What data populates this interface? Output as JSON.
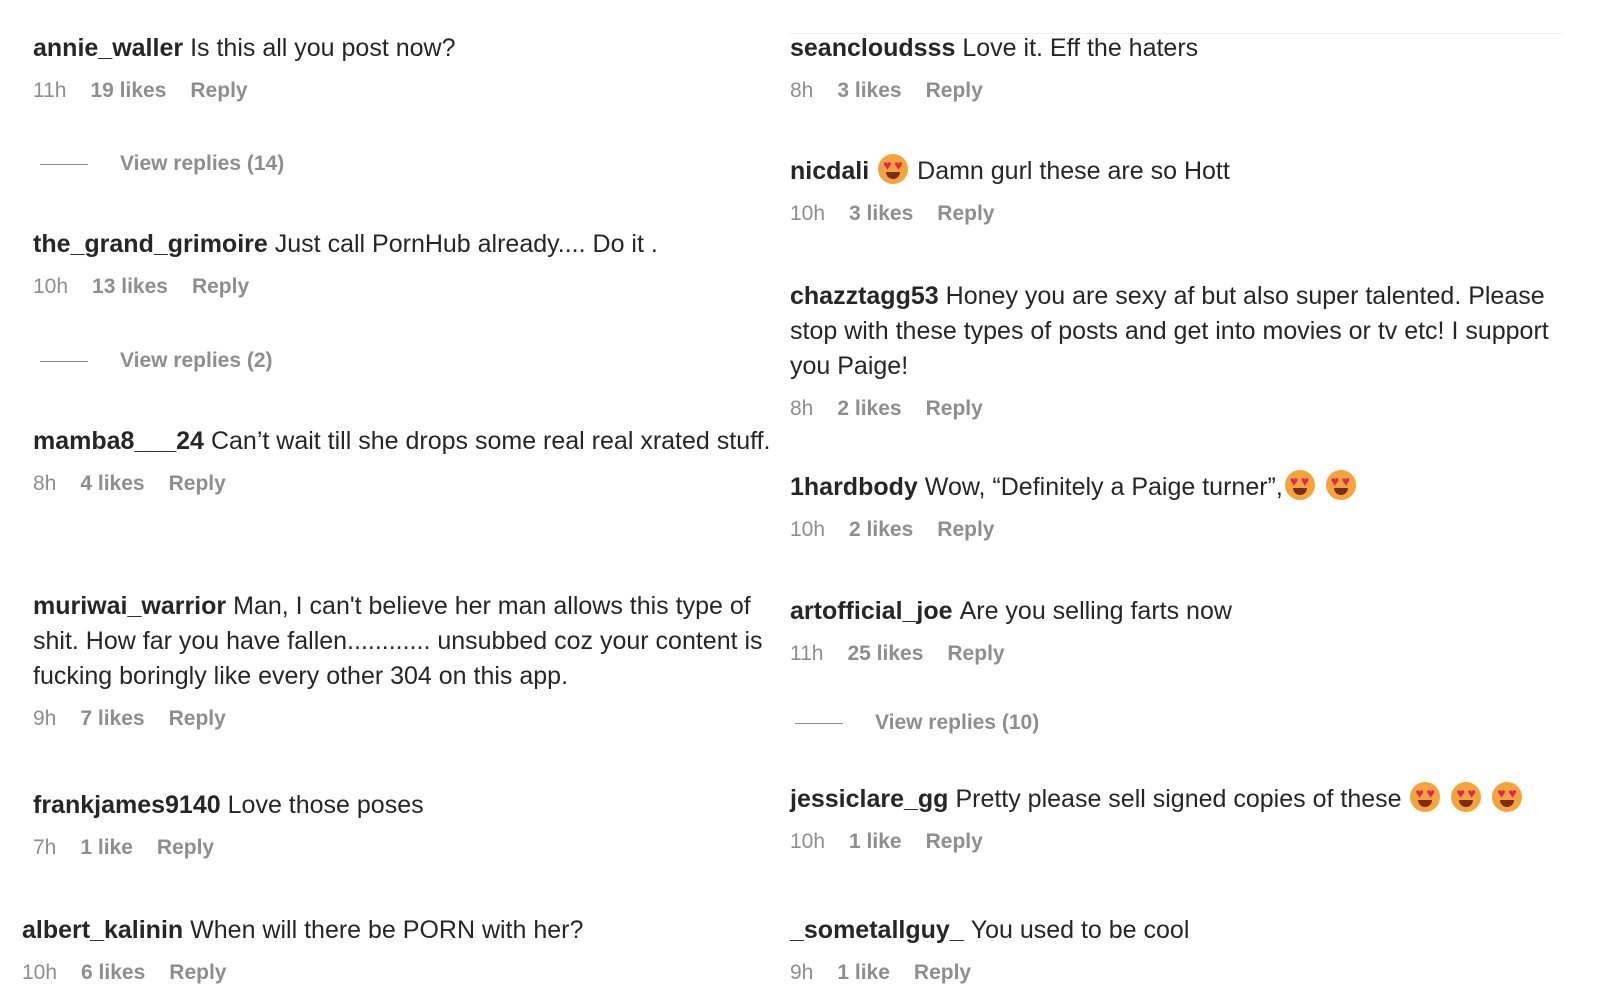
{
  "left_column": {
    "comments": [
      {
        "user": "annie_waller",
        "text": "Is this all you post now?",
        "time": "11h",
        "likes": "19 likes",
        "reply": "Reply"
      },
      {
        "user": "the_grand_grimoire",
        "text": "Just call PornHub already.... Do it .",
        "time": "10h",
        "likes": "13 likes",
        "reply": "Reply"
      },
      {
        "user": "mamba8___24",
        "text": "Can’t wait till she drops some real real xrated stuff.",
        "time": "8h",
        "likes": "4 likes",
        "reply": "Reply"
      },
      {
        "user": "muriwai_warrior",
        "text": "Man, I can't believe her man allows this type of shit. How far you have fallen............ unsubbed coz your content is fucking boringly like every other 304 on this app.",
        "time": "9h",
        "likes": "7 likes",
        "reply": "Reply"
      },
      {
        "user": "frankjames9140",
        "text": "Love those poses",
        "time": "7h",
        "likes": "1 like",
        "reply": "Reply"
      },
      {
        "user": "albert_kalinin",
        "text": "When will there be PORN with her?",
        "time": "10h",
        "likes": "6 likes",
        "reply": "Reply"
      }
    ],
    "view_replies": [
      "View replies (14)",
      "View replies (2)"
    ]
  },
  "right_column": {
    "comments": [
      {
        "user": "seancloudsss",
        "text": "Love it. Eff the haters",
        "time": "8h",
        "likes": "3 likes",
        "reply": "Reply"
      },
      {
        "user": "nicdali",
        "text": "Damn gurl these are so Hott",
        "time": "10h",
        "likes": "3 likes",
        "reply": "Reply"
      },
      {
        "user": "chazztagg53",
        "text": "Honey you are sexy af but also super talented. Please stop with these types of posts and get into movies or tv etc! I support you Paige!",
        "time": "8h",
        "likes": "2 likes",
        "reply": "Reply"
      },
      {
        "user": "1hardbody",
        "text": "Wow, “Definitely a Paige turner”,",
        "time": "10h",
        "likes": "2 likes",
        "reply": "Reply"
      },
      {
        "user": "artofficial_joe",
        "text": "Are you selling farts now",
        "time": "11h",
        "likes": "25 likes",
        "reply": "Reply"
      },
      {
        "user": "jessiclare_gg",
        "text": "Pretty please sell signed copies of these",
        "time": "10h",
        "likes": "1 like",
        "reply": "Reply"
      },
      {
        "user": "_sometallguy_",
        "text": "You used to be cool",
        "time": "9h",
        "likes": "1 like",
        "reply": "Reply"
      }
    ],
    "view_replies": [
      "View replies (10)"
    ]
  },
  "icons": {
    "emoji": "heart-eyes-emoji-icon"
  }
}
